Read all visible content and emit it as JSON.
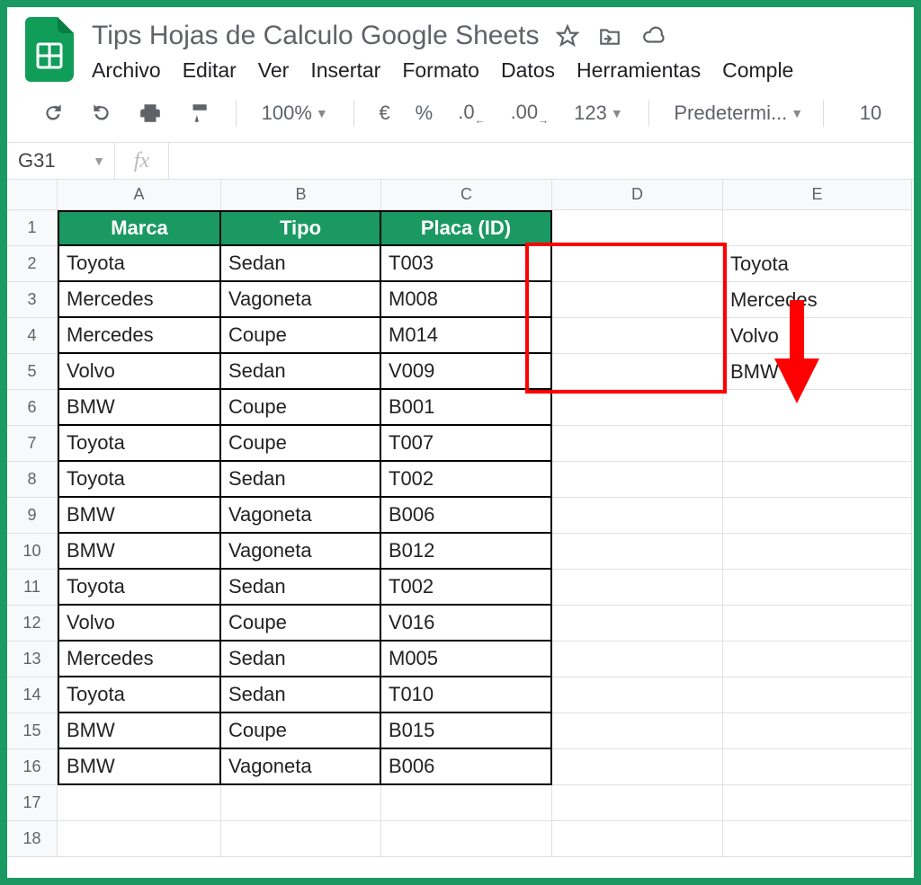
{
  "doc": {
    "title": "Tips Hojas de Calculo Google Sheets"
  },
  "menu": {
    "archivo": "Archivo",
    "editar": "Editar",
    "ver": "Ver",
    "insertar": "Insertar",
    "formato": "Formato",
    "datos": "Datos",
    "herramientas": "Herramientas",
    "complementos": "Comple"
  },
  "toolbar": {
    "zoom": "100%",
    "currency": "€",
    "percent": "%",
    "dec0": ".0",
    "dec00": ".00",
    "numfmt": "123",
    "font": "Predetermi...",
    "fontsize": "10"
  },
  "namebox": "G31",
  "columns": [
    "A",
    "B",
    "C",
    "D",
    "E"
  ],
  "rowcount": 18,
  "headers": {
    "marca": "Marca",
    "tipo": "Tipo",
    "placa": "Placa (ID)"
  },
  "data": [
    {
      "marca": "Toyota",
      "tipo": "Sedan",
      "placa": "T003"
    },
    {
      "marca": "Mercedes",
      "tipo": "Vagoneta",
      "placa": "M008"
    },
    {
      "marca": "Mercedes",
      "tipo": "Coupe",
      "placa": "M014"
    },
    {
      "marca": "Volvo",
      "tipo": "Sedan",
      "placa": "V009"
    },
    {
      "marca": "BMW",
      "tipo": "Coupe",
      "placa": "B001"
    },
    {
      "marca": "Toyota",
      "tipo": "Coupe",
      "placa": "T007"
    },
    {
      "marca": "Toyota",
      "tipo": "Sedan",
      "placa": "T002"
    },
    {
      "marca": "BMW",
      "tipo": "Vagoneta",
      "placa": "B006"
    },
    {
      "marca": "BMW",
      "tipo": "Vagoneta",
      "placa": "B012"
    },
    {
      "marca": "Toyota",
      "tipo": "Sedan",
      "placa": "T002"
    },
    {
      "marca": "Volvo",
      "tipo": "Coupe",
      "placa": "V016"
    },
    {
      "marca": "Mercedes",
      "tipo": "Sedan",
      "placa": "M005"
    },
    {
      "marca": "Toyota",
      "tipo": "Sedan",
      "placa": "T010"
    },
    {
      "marca": "BMW",
      "tipo": "Coupe",
      "placa": "B015"
    },
    {
      "marca": "BMW",
      "tipo": "Vagoneta",
      "placa": "B006"
    }
  ],
  "unique_list": [
    "Toyota",
    "Mercedes",
    "Volvo",
    "BMW"
  ]
}
